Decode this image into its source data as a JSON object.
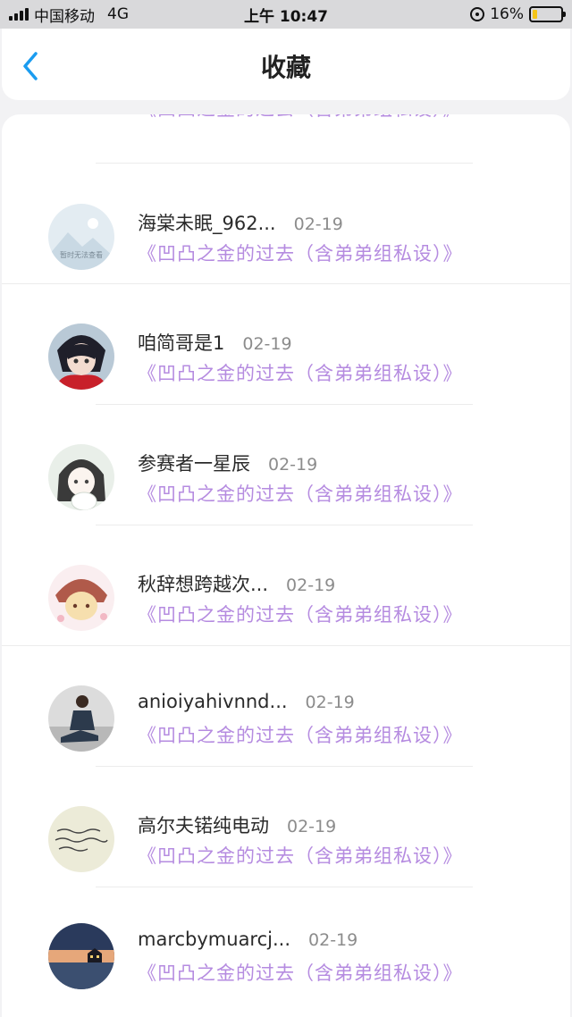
{
  "status_bar": {
    "carrier": "中国移动",
    "network": "4G",
    "time": "上午 10:47",
    "battery_percent": "16%",
    "battery_level": 0.16
  },
  "nav": {
    "back_icon": "chevron-left-icon",
    "title": "收藏"
  },
  "colors": {
    "title_purple": "#b58be0",
    "accent_blue": "#1a9cf0"
  },
  "items": [
    {
      "name": "",
      "date": "",
      "title": "《凹凸之金的过去（含弟弟组私设）》"
    },
    {
      "name": "海棠未眠_962...",
      "date": "02-19",
      "title": "《凹凸之金的过去（含弟弟组私设）》",
      "avatar_caption": "暂时无法查看"
    },
    {
      "name": "咱简哥是1",
      "date": "02-19",
      "title": "《凹凸之金的过去（含弟弟组私设）》"
    },
    {
      "name": "参赛者一星辰",
      "date": "02-19",
      "title": "《凹凸之金的过去（含弟弟组私设）》"
    },
    {
      "name": "秋辞想跨越次...",
      "date": "02-19",
      "title": "《凹凸之金的过去（含弟弟组私设）》"
    },
    {
      "name": "anioiyahivnnd...",
      "date": "02-19",
      "title": "《凹凸之金的过去（含弟弟组私设）》"
    },
    {
      "name": "高尔夫锘纯电动",
      "date": "02-19",
      "title": "《凹凸之金的过去（含弟弟组私设）》"
    },
    {
      "name": "marcbymuarcj...",
      "date": "02-19",
      "title": "《凹凸之金的过去（含弟弟组私设）》"
    }
  ]
}
